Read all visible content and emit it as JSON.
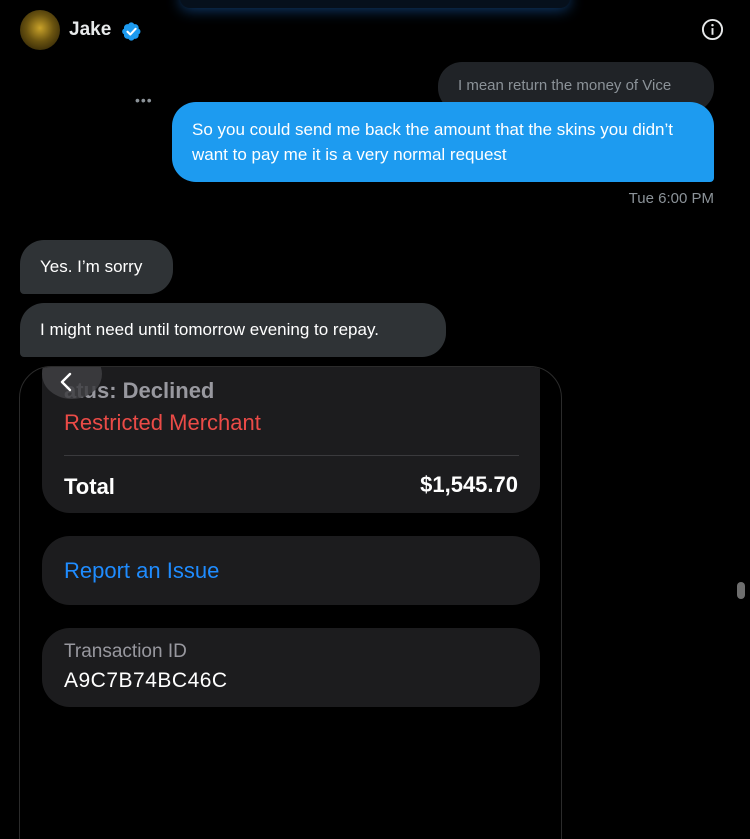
{
  "header": {
    "contact_name": "Jake",
    "verified": true,
    "accent_color": "#1d9bf0"
  },
  "conversation": {
    "quoted_message": "I mean return the money of Vice",
    "more_menu": "•••",
    "sent_message": "So you could send me back the amount that the skins you didn’t want to pay me it is a very normal request",
    "timestamp": "Tue 6:00 PM",
    "received_messages": [
      {
        "text": "Yes. I’m sorry"
      },
      {
        "text": "I might need until tomorrow evening to repay."
      }
    ]
  },
  "attachment": {
    "status_text": "atus: Declined",
    "merchant_text": "Restricted Merchant",
    "total_label": "Total",
    "total_value": "$1,545.70",
    "report_label": "Report an Issue",
    "transaction_id_label": "Transaction ID",
    "transaction_id_value": "A9C7B74BC46C",
    "colors": {
      "declined": "#eb4b47",
      "link": "#1f8cff"
    }
  }
}
